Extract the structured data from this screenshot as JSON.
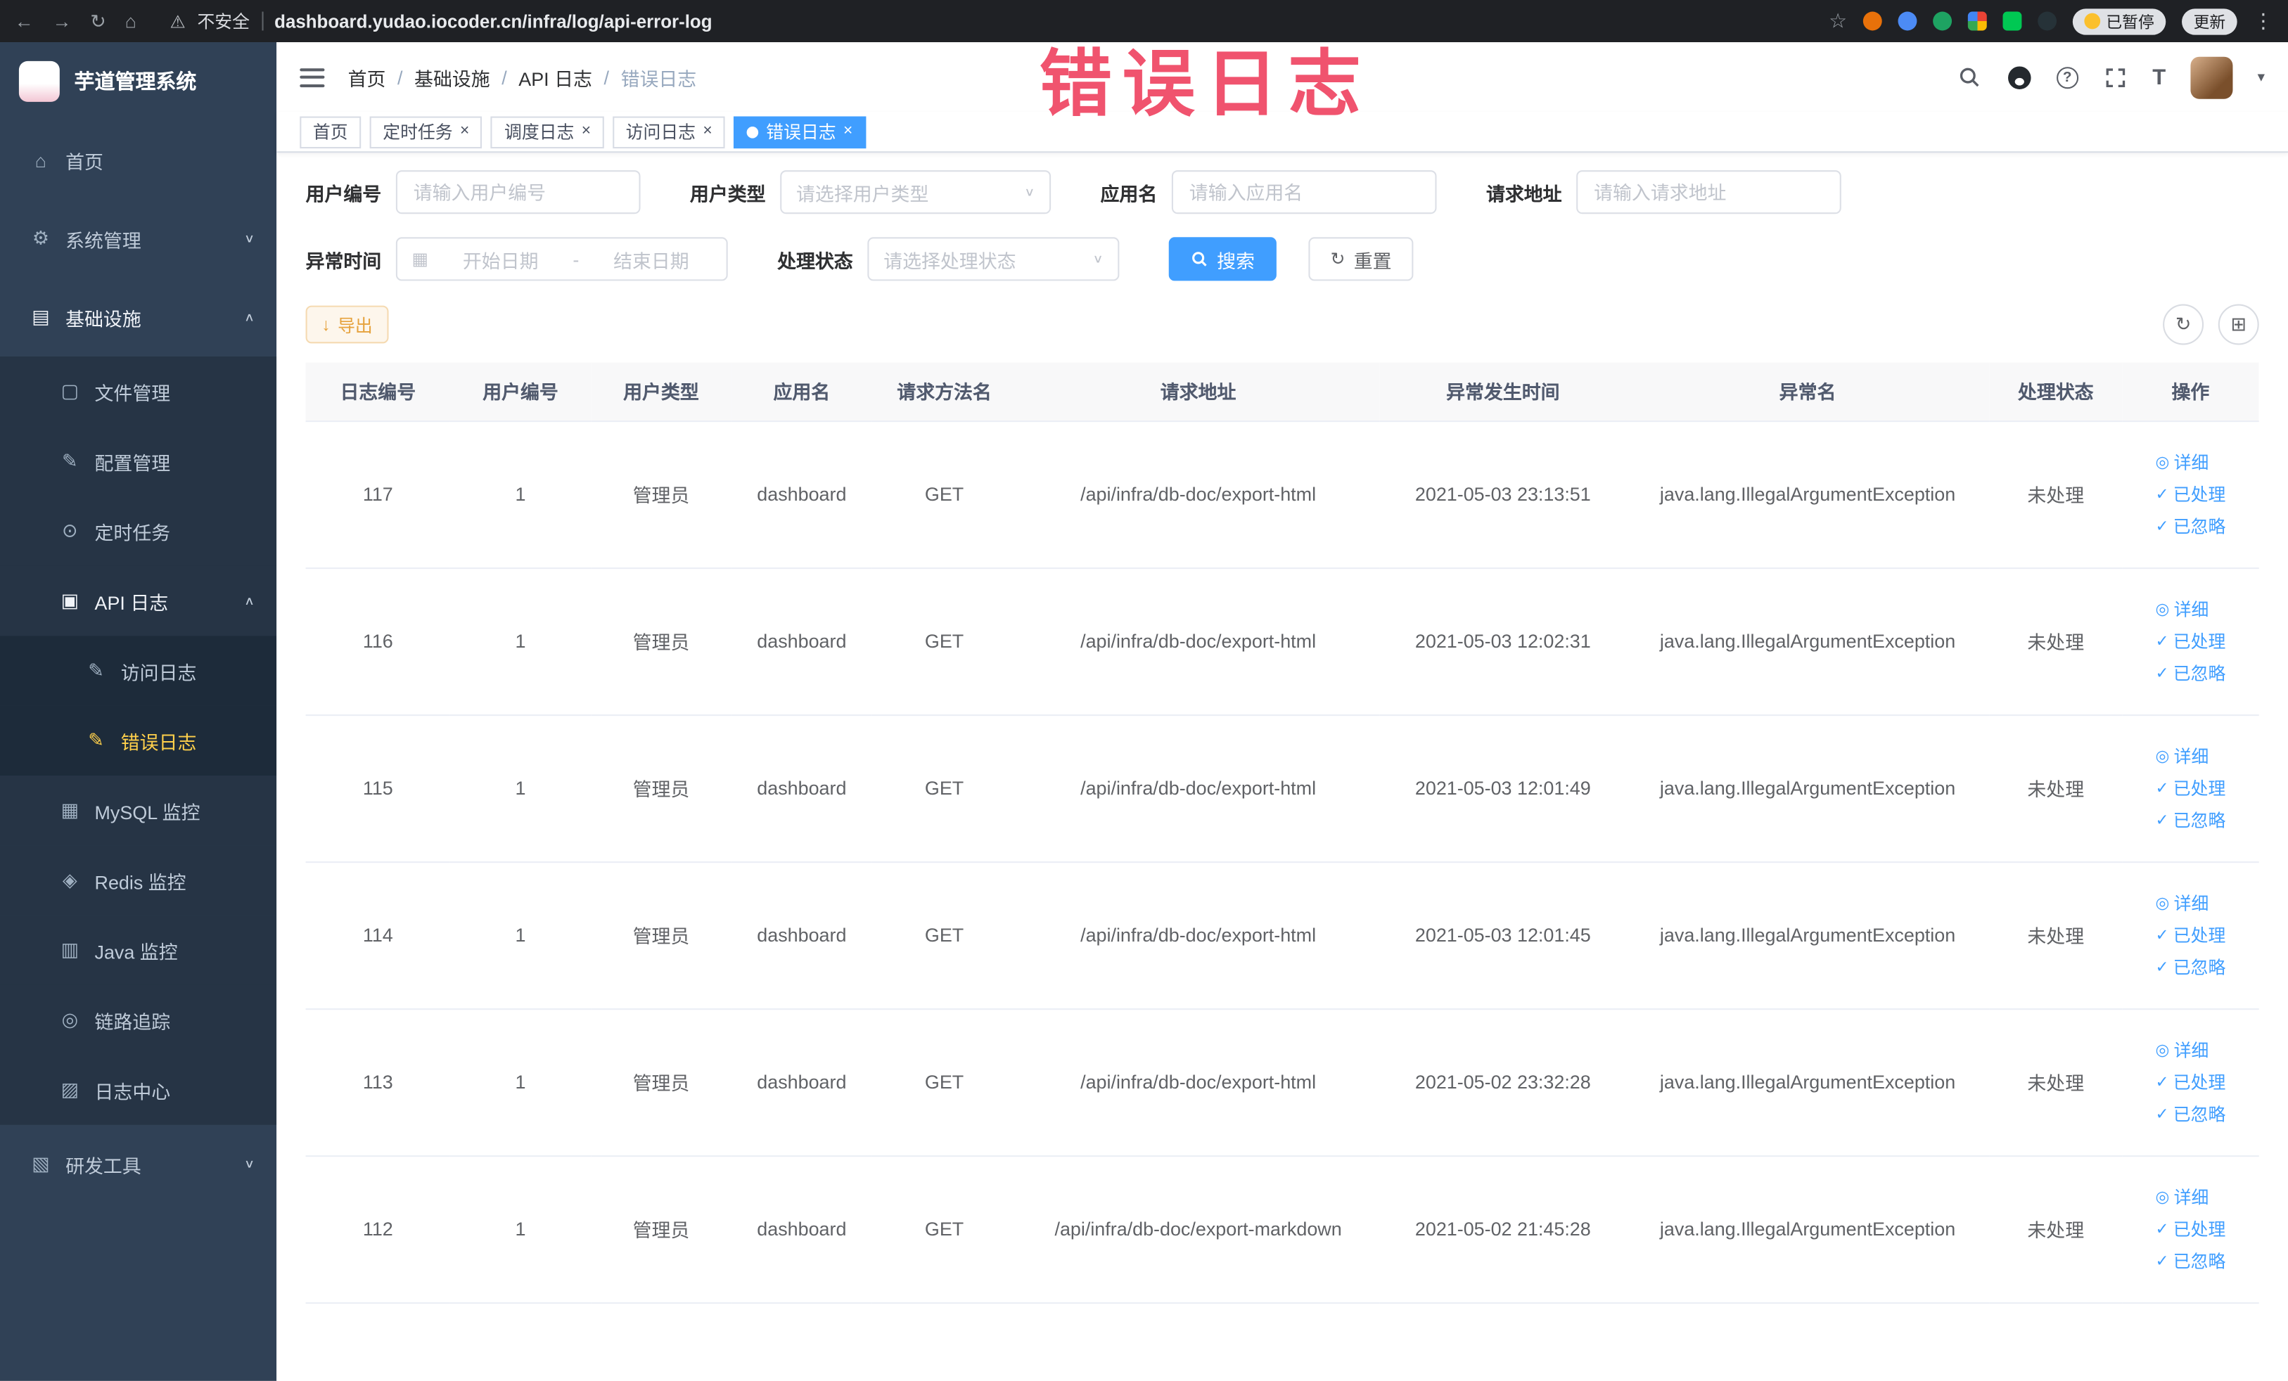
{
  "browser": {
    "security_label": "不安全",
    "url": "dashboard.yudao.iocoder.cn/infra/log/api-error-log",
    "paused_badge": "已暂停",
    "update_label": "更新"
  },
  "annotation": {
    "text": "错误日志"
  },
  "icons": {
    "back-icon": "←",
    "forward-icon": "→",
    "reload-icon": "↻",
    "home-browser-icon": "⌂",
    "warning-icon": "⚠",
    "star-icon": "☆",
    "kebab-icon": "⋮",
    "home-icon": "⌂",
    "gear-icon": "⚙",
    "infrastructure-icon": "▤",
    "file-icon": "▢",
    "config-icon": "✎",
    "timer-icon": "⊙",
    "api-log-icon": "▣",
    "access-log-icon": "✎",
    "error-log-icon": "✎",
    "mysql-icon": "▦",
    "redis-icon": "◈",
    "java-icon": "▥",
    "trace-icon": "◎",
    "log-center-icon": "▨",
    "devtools-icon": "▧",
    "chevron-down-icon": "∨",
    "chevron-up-icon": "∧",
    "close-icon": "×",
    "check-icon": "✓",
    "eye-icon": "◎",
    "download-icon": "↓",
    "calendar-icon": "▦",
    "refresh-icon": "↻",
    "column-settings-icon": "⊞",
    "caret-down-icon": "▾",
    "help-icon": "?",
    "font-size-icon": "T"
  },
  "sidebar": {
    "logo_title": "芋道管理系统",
    "items": [
      {
        "key": "home",
        "label": "首页",
        "icon": "home-icon",
        "level": 1
      },
      {
        "key": "system",
        "label": "系统管理",
        "icon": "gear-icon",
        "level": 1,
        "expandable": true,
        "expanded": false
      },
      {
        "key": "infra",
        "label": "基础设施",
        "icon": "infrastructure-icon",
        "level": 1,
        "expandable": true,
        "expanded": true,
        "highlight": true
      },
      {
        "key": "file",
        "label": "文件管理",
        "icon": "file-icon",
        "level": 2
      },
      {
        "key": "config",
        "label": "配置管理",
        "icon": "config-icon",
        "level": 2
      },
      {
        "key": "job",
        "label": "定时任务",
        "icon": "timer-icon",
        "level": 2
      },
      {
        "key": "api-log",
        "label": "API 日志",
        "icon": "api-log-icon",
        "level": 2,
        "expandable": true,
        "expanded": true,
        "highlight": true
      },
      {
        "key": "access-log",
        "label": "访问日志",
        "icon": "access-log-icon",
        "level": 3
      },
      {
        "key": "error-log",
        "label": "错误日志",
        "icon": "error-log-icon",
        "level": 3,
        "active": true
      },
      {
        "key": "mysql",
        "label": "MySQL 监控",
        "icon": "mysql-icon",
        "level": 2
      },
      {
        "key": "redis",
        "label": "Redis 监控",
        "icon": "redis-icon",
        "level": 2
      },
      {
        "key": "java",
        "label": "Java 监控",
        "icon": "java-icon",
        "level": 2
      },
      {
        "key": "trace",
        "label": "链路追踪",
        "icon": "trace-icon",
        "level": 2
      },
      {
        "key": "log-center",
        "label": "日志中心",
        "icon": "log-center-icon",
        "level": 2
      },
      {
        "key": "devtools",
        "label": "研发工具",
        "icon": "devtools-icon",
        "level": 1,
        "expandable": true,
        "expanded": false
      }
    ]
  },
  "header": {
    "breadcrumb": [
      "首页",
      "基础设施",
      "API 日志",
      "错误日志"
    ]
  },
  "tabs": [
    {
      "label": "首页",
      "closable": false,
      "active": false
    },
    {
      "label": "定时任务",
      "closable": true,
      "active": false
    },
    {
      "label": "调度日志",
      "closable": true,
      "active": false
    },
    {
      "label": "访问日志",
      "closable": true,
      "active": false
    },
    {
      "label": "错误日志",
      "closable": true,
      "active": true
    }
  ],
  "filters": {
    "user_id": {
      "label": "用户编号",
      "placeholder": "请输入用户编号"
    },
    "user_type": {
      "label": "用户类型",
      "placeholder": "请选择用户类型"
    },
    "app_name": {
      "label": "应用名",
      "placeholder": "请输入应用名"
    },
    "request_url": {
      "label": "请求地址",
      "placeholder": "请输入请求地址"
    },
    "exception_time": {
      "label": "异常时间",
      "start_placeholder": "开始日期",
      "separator": "-",
      "end_placeholder": "结束日期"
    },
    "process_status": {
      "label": "处理状态",
      "placeholder": "请选择处理状态"
    },
    "search_label": "搜索",
    "reset_label": "重置"
  },
  "toolbar": {
    "export_label": "导出"
  },
  "table": {
    "columns": [
      "日志编号",
      "用户编号",
      "用户类型",
      "应用名",
      "请求方法名",
      "请求地址",
      "异常发生时间",
      "异常名",
      "处理状态",
      "操作"
    ],
    "action_labels": {
      "detail": "详细",
      "process": "已处理",
      "ignore": "已忽略"
    },
    "rows": [
      {
        "log_id": "117",
        "user_id": "1",
        "user_type": "管理员",
        "app_name": "dashboard",
        "method": "GET",
        "url": "/api/infra/db-doc/export-html",
        "time": "2021-05-03 23:13:51",
        "exception": "java.lang.IllegalArgumentException",
        "status": "未处理"
      },
      {
        "log_id": "116",
        "user_id": "1",
        "user_type": "管理员",
        "app_name": "dashboard",
        "method": "GET",
        "url": "/api/infra/db-doc/export-html",
        "time": "2021-05-03 12:02:31",
        "exception": "java.lang.IllegalArgumentException",
        "status": "未处理"
      },
      {
        "log_id": "115",
        "user_id": "1",
        "user_type": "管理员",
        "app_name": "dashboard",
        "method": "GET",
        "url": "/api/infra/db-doc/export-html",
        "time": "2021-05-03 12:01:49",
        "exception": "java.lang.IllegalArgumentException",
        "status": "未处理"
      },
      {
        "log_id": "114",
        "user_id": "1",
        "user_type": "管理员",
        "app_name": "dashboard",
        "method": "GET",
        "url": "/api/infra/db-doc/export-html",
        "time": "2021-05-03 12:01:45",
        "exception": "java.lang.IllegalArgumentException",
        "status": "未处理"
      },
      {
        "log_id": "113",
        "user_id": "1",
        "user_type": "管理员",
        "app_name": "dashboard",
        "method": "GET",
        "url": "/api/infra/db-doc/export-html",
        "time": "2021-05-02 23:32:28",
        "exception": "java.lang.IllegalArgumentException",
        "status": "未处理"
      },
      {
        "log_id": "112",
        "user_id": "1",
        "user_type": "管理员",
        "app_name": "dashboard",
        "method": "GET",
        "url": "/api/infra/db-doc/export-markdown",
        "time": "2021-05-02 21:45:28",
        "exception": "java.lang.IllegalArgumentException",
        "status": "未处理"
      }
    ]
  },
  "colors": {
    "accent": "#409eff",
    "sidebar_active_text": "#ffd04b",
    "warning": "#e6a23c",
    "annotation": "#ef4562"
  }
}
